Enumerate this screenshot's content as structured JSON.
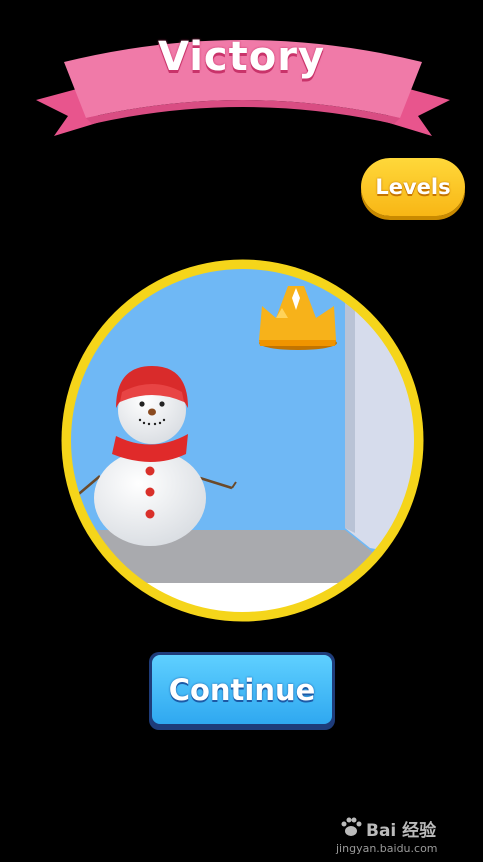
{
  "banner": {
    "title": "Victory",
    "color": "#f07aa8"
  },
  "levels_button": {
    "label": "Levels",
    "color": "#fcc82a"
  },
  "scene": {
    "ring_color": "#f5d51a",
    "sky_color": "#6fb8f5",
    "character": "snowman",
    "prop": "crown"
  },
  "continue_button": {
    "label": "Continue",
    "color": "#3db8f5"
  },
  "watermark": {
    "brand": "Bai 经验",
    "url": "jingyan.baidu.com",
    "logo_icon": "paw-icon"
  }
}
